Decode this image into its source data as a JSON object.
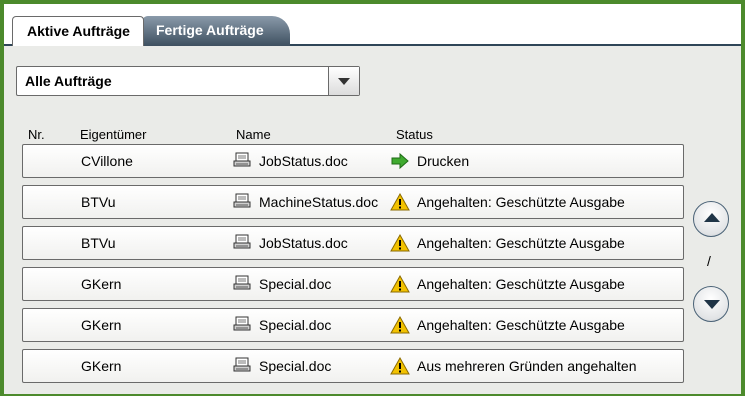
{
  "tabs": [
    {
      "label": "Aktive Aufträge",
      "active": true
    },
    {
      "label": "Fertige Aufträge",
      "active": false
    }
  ],
  "filter": {
    "selected": "Alle Aufträge"
  },
  "columns": {
    "nr": "Nr.",
    "owner": "Eigentümer",
    "name": "Name",
    "status": "Status"
  },
  "jobs": [
    {
      "owner": "CVillone",
      "name": "JobStatus.doc",
      "status": "Drucken",
      "status_icon": "green-arrow-icon"
    },
    {
      "owner": "BTVu",
      "name": "MachineStatus.doc",
      "status": "Angehalten: Geschützte Ausgabe",
      "status_icon": "warning-icon"
    },
    {
      "owner": "BTVu",
      "name": "JobStatus.doc",
      "status": "Angehalten: Geschützte Ausgabe",
      "status_icon": "warning-icon"
    },
    {
      "owner": "GKern",
      "name": "Special.doc",
      "status": "Angehalten: Geschützte Ausgabe",
      "status_icon": "warning-icon"
    },
    {
      "owner": "GKern",
      "name": "Special.doc",
      "status": "Angehalten: Geschützte Ausgabe",
      "status_icon": "warning-icon"
    },
    {
      "owner": "GKern",
      "name": "Special.doc",
      "status": "Aus mehreren Gründen angehalten",
      "status_icon": "warning-icon"
    }
  ],
  "pagination": {
    "indicator": "/"
  },
  "colors": {
    "frame": "#4c8a2c",
    "panel": "#eaebe8",
    "tab_dark": "#3e5060",
    "warning": "#f2c200",
    "go_arrow": "#3faa2f"
  }
}
